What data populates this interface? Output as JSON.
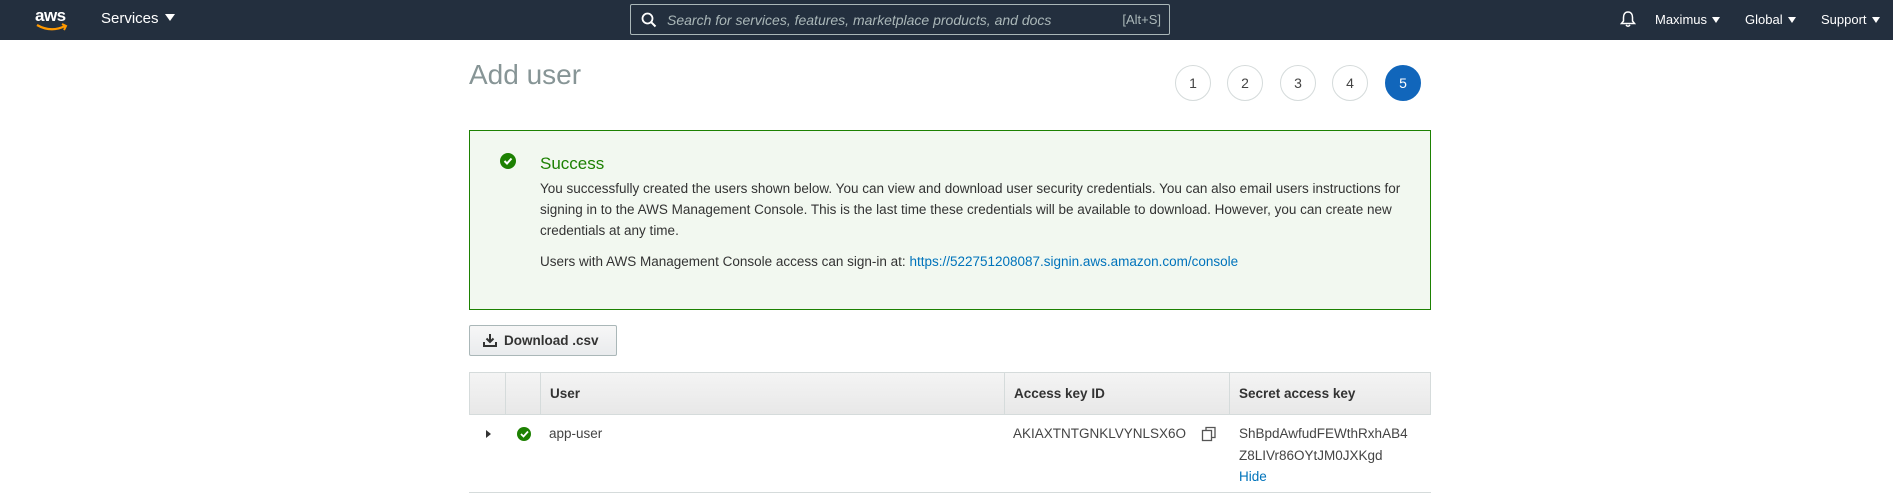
{
  "nav": {
    "logo_text": "aws",
    "services_label": "Services",
    "search_placeholder": "Search for services, features, marketplace products, and docs",
    "search_shortcut": "[Alt+S]",
    "user_label": "Maximus",
    "region_label": "Global",
    "support_label": "Support",
    "icons": [
      "aws-logo",
      "caret-down-icon",
      "search-icon",
      "bell-icon"
    ]
  },
  "page": {
    "title": "Add user",
    "steps": [
      "1",
      "2",
      "3",
      "4",
      "5"
    ],
    "active_step": "5"
  },
  "success": {
    "title": "Success",
    "body": "You successfully created the users shown below. You can view and download user security credentials. You can also email users instructions for signing in to the AWS Management Console. This is the last time these credentials will be available to download. However, you can create new credentials at any time.",
    "signin_prefix": "Users with AWS Management Console access can sign-in at:",
    "signin_url": "https://522751208087.signin.aws.amazon.com/console"
  },
  "download_label": "Download .csv",
  "table": {
    "columns": [
      "User",
      "Access key ID",
      "Secret access key"
    ],
    "rows": [
      {
        "user": "app-user",
        "access_key_id": "AKIAXTNTGNKLVYNLSX6O",
        "secret_line1": "ShBpdAwfudFEWthRxhAB4",
        "secret_line2": "Z8LIVr86OYtJM0JXKgd",
        "hide_label": "Hide"
      }
    ]
  },
  "colors": {
    "nav_bg": "#232f3e",
    "success_green": "#1d8102",
    "link_blue": "#0073bb",
    "step_active": "#1166bb"
  }
}
